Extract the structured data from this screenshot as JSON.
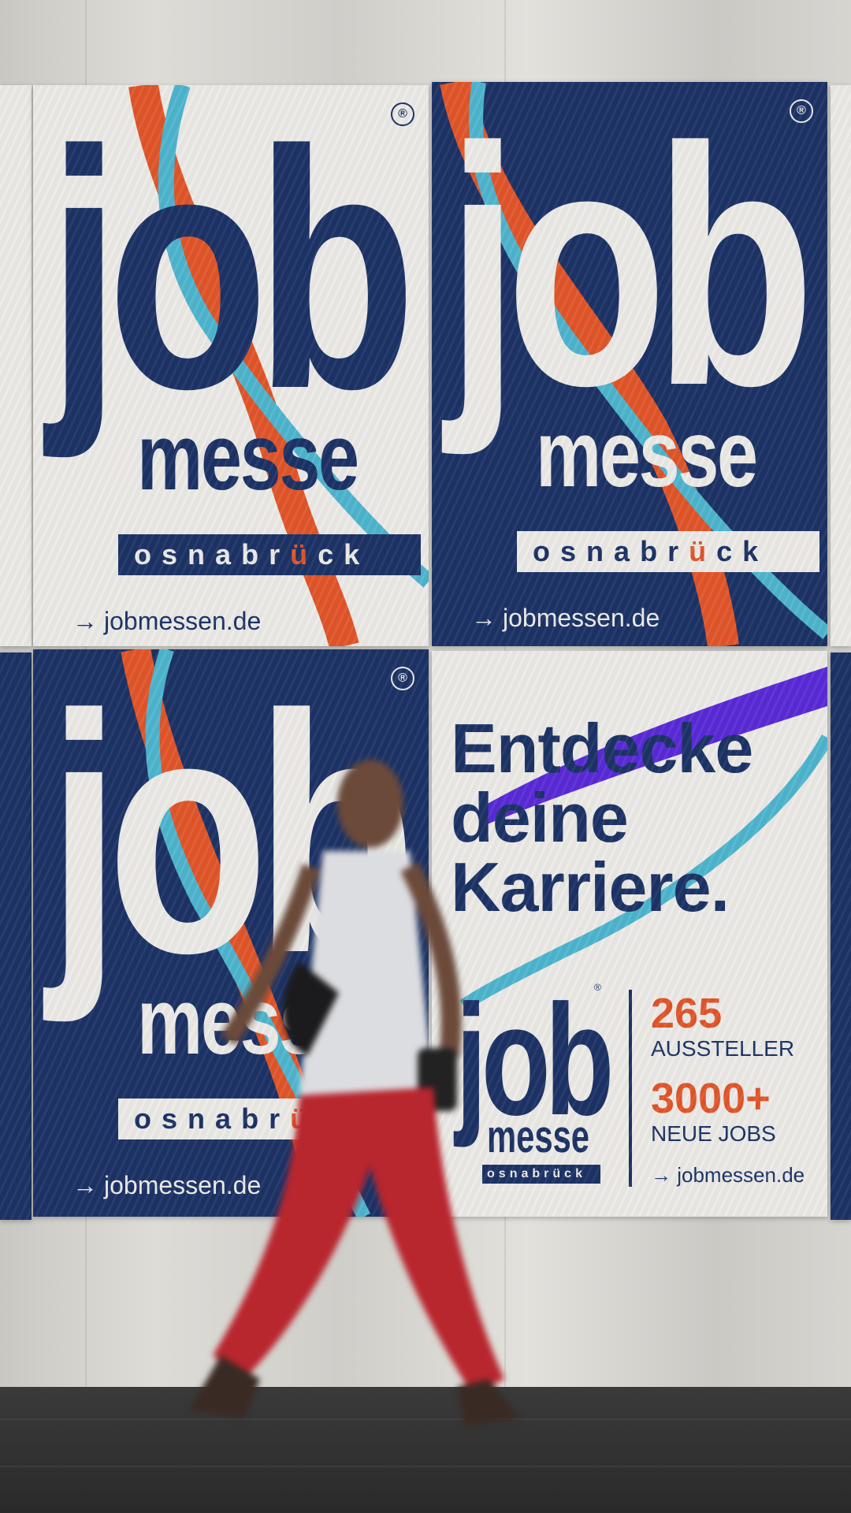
{
  "brand": {
    "job": "job",
    "messe": "messe",
    "city_letters": [
      "o",
      "s",
      "n",
      "a",
      "b",
      "r",
      "ü",
      "c",
      "k"
    ],
    "registered": "®",
    "url": "jobmessen.de",
    "arrow": "→"
  },
  "slogan_poster": {
    "lines": [
      "Entdecke",
      "deine",
      "Karriere."
    ],
    "stat1_value": "265",
    "stat1_label": "AUSSTELLER",
    "stat2_value": "3000+",
    "stat2_label": "NEUE JOBS",
    "url": "jobmessen.de"
  },
  "colors": {
    "navy": "#1d3366",
    "paper": "#ecebe8",
    "orange": "#e2562a",
    "teal": "#4fb6cf",
    "violet": "#5a2bd8"
  }
}
